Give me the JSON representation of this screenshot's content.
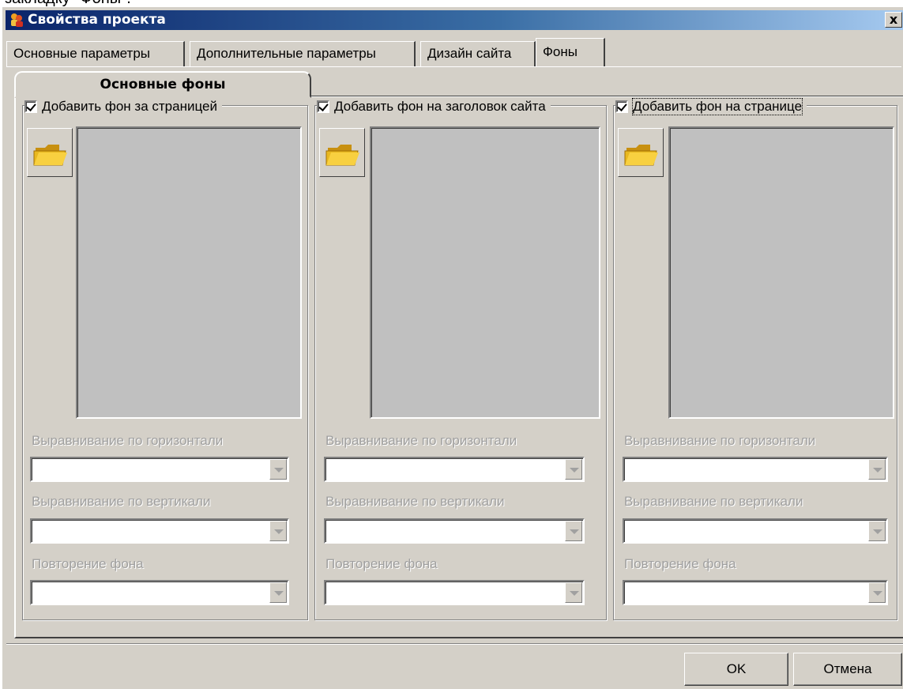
{
  "caption": "закладку \"Фоны\".",
  "window": {
    "title": "Свойства проекта",
    "close_glyph": "x"
  },
  "tabs": [
    "Основные параметры",
    "Дополнительные параметры",
    "Дизайн сайта",
    "Фоны"
  ],
  "active_tab": "Фоны",
  "inner_tab": "Основные фоны",
  "columns": [
    {
      "checkbox_label": "Добавить фон за страницей",
      "checked": true,
      "folder_icon": "folder-open-icon",
      "h_align_label": "Выравнивание по горизонтали",
      "v_align_label": " Выравнивание по вертикали",
      "repeat_label": "Повторение фона"
    },
    {
      "checkbox_label": "Добавить фон на заголовок сайта",
      "checked": true,
      "folder_icon": "folder-open-icon",
      "h_align_label": "Выравнивание по горизонтали",
      "v_align_label": "Выравнивание по вертикали",
      "repeat_label": "Повторение фона"
    },
    {
      "checkbox_label": "Добавить фон на странице",
      "checked": true,
      "folder_icon": "folder-open-icon",
      "h_align_label": "Выравнивание по горизонтали",
      "v_align_label": "Выравнивание по вертикали",
      "repeat_label": "Повторение фона"
    }
  ],
  "buttons": {
    "ok": "OK",
    "cancel": "Отмена"
  },
  "colors": {
    "titlebar_start": "#0a246a",
    "titlebar_end": "#a6caf0",
    "face": "#d4d0c8",
    "preview": "#c0c0c0",
    "disabled_text": "#a0a0a0",
    "folder": "#e8b820"
  }
}
